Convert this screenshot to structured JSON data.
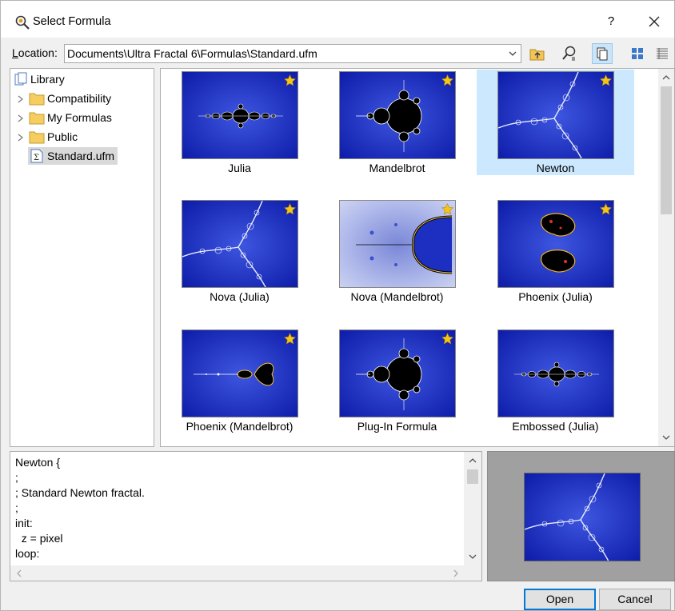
{
  "window": {
    "title": "Select Formula",
    "help_label": "?",
    "icons": {
      "app": "formula-magnifier-icon",
      "close": "close-icon"
    }
  },
  "location": {
    "label_prefix": "L",
    "label_rest": "ocation:",
    "value": "Documents\\Ultra Fractal 6\\Formulas\\Standard.ufm",
    "toolbar_icons": [
      "up-folder-icon",
      "search-icon",
      "copy-view-icon",
      "large-icons-view-icon",
      "details-view-icon"
    ]
  },
  "tree": {
    "root": "Library",
    "items": [
      {
        "label": "Compatibility",
        "icon": "folder-icon",
        "expandable": true
      },
      {
        "label": "My Formulas",
        "icon": "folder-icon",
        "expandable": true
      },
      {
        "label": "Public",
        "icon": "folder-icon",
        "expandable": true
      },
      {
        "label": "Standard.ufm",
        "icon": "formula-file-icon",
        "expandable": false,
        "selected": true
      }
    ]
  },
  "gallery": {
    "items": [
      {
        "label": "Julia",
        "fractal": "julia",
        "favorite": true
      },
      {
        "label": "Mandelbrot",
        "fractal": "mandelbrot",
        "favorite": true
      },
      {
        "label": "Newton",
        "fractal": "newton",
        "favorite": true,
        "selected": true
      },
      {
        "label": "Nova (Julia)",
        "fractal": "newton",
        "favorite": true
      },
      {
        "label": "Nova (Mandelbrot)",
        "fractal": "nova-mandel",
        "favorite": true
      },
      {
        "label": "Phoenix (Julia)",
        "fractal": "phoenix",
        "favorite": true
      },
      {
        "label": "Phoenix (Mandelbrot)",
        "fractal": "phoenix-mandel",
        "favorite": true
      },
      {
        "label": "Plug-In Formula",
        "fractal": "mandelbrot",
        "favorite": true
      },
      {
        "label": "Embossed (Julia)",
        "fractal": "julia",
        "favorite": false
      }
    ]
  },
  "code": {
    "lines": [
      "Newton {",
      ";",
      "; Standard Newton fractal.",
      ";",
      "init:",
      "  z = pixel",
      "loop:"
    ]
  },
  "buttons": {
    "open": "Open",
    "cancel": "Cancel"
  },
  "colors": {
    "fractal_blue": "#1a2bb8",
    "selection": "#cce8ff",
    "accent": "#0078d7",
    "star": "#f5c518"
  }
}
